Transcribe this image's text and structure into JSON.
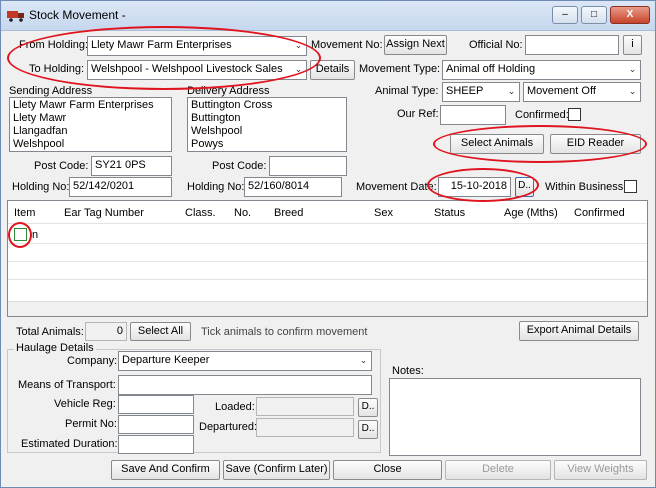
{
  "window": {
    "title": "Stock Movement -",
    "minimize": "–",
    "maximize": "□",
    "close": "X"
  },
  "holding": {
    "from_label": "From Holding:",
    "from_value": "Llety Mawr Farm Enterprises",
    "to_label": "To Holding:",
    "to_value": "Welshpool - Welshpool Livestock Sales",
    "details_button": "Details"
  },
  "movement_no": {
    "label": "Movement No:",
    "button": "Assign Next"
  },
  "official_no": {
    "label": "Official No:",
    "value": "",
    "button": "i"
  },
  "movement_type": {
    "label": "Movement Type:",
    "value": "Animal off Holding"
  },
  "animal_type": {
    "label": "Animal Type:",
    "value": "SHEEP",
    "direction": "Movement Off"
  },
  "our_ref": {
    "label": "Our Ref:",
    "value": ""
  },
  "confirmed": {
    "label": "Confirmed:"
  },
  "sending": {
    "label": "Sending Address",
    "lines": [
      "Llety Mawr Farm Enterprises",
      "Llety Mawr",
      "Llangadfan",
      "Welshpool"
    ],
    "postcode_label": "Post Code:",
    "postcode": "SY21 0PS",
    "holding_label": "Holding No:",
    "holding_no": "52/142/0201"
  },
  "delivery": {
    "label": "Delivery Address",
    "lines": [
      "Buttington Cross",
      "Buttington",
      "Welshpool",
      "Powys"
    ],
    "postcode_label": "Post Code:",
    "postcode": "",
    "holding_label": "Holding No:",
    "holding_no": "52/160/8014"
  },
  "buttons": {
    "select_animals": "Select Animals",
    "eid_reader": "EID Reader",
    "select_all": "Select All",
    "export": "Export Animal Details",
    "save_confirm": "Save And Confirm",
    "save_confirm_later": "Save (Confirm Later)",
    "close": "Close",
    "delete": "Delete",
    "view_weights": "View Weights"
  },
  "movement_date": {
    "label": "Movement Date:",
    "value": "15-10-2018",
    "button": "D.."
  },
  "within_business": {
    "label": "Within Business"
  },
  "grid": {
    "columns": [
      "Item",
      "Ear Tag Number",
      "Class.",
      "No.",
      "Breed",
      "Sex",
      "Status",
      "Age (Mths)",
      "Confirmed"
    ],
    "row_fragment": "n"
  },
  "totals": {
    "label": "Total Animals:",
    "value": "0",
    "hint": "Tick animals to confirm movement"
  },
  "haulage": {
    "group_label": "Haulage Details",
    "company_label": "Company:",
    "company_value": "Departure Keeper",
    "transport_label": "Means of Transport:",
    "transport_value": "",
    "vehicle_label": "Vehicle Reg:",
    "permit_label": "Permit No:",
    "duration_label": "Estimated Duration:",
    "loaded_label": "Loaded:",
    "departured_label": "Departured:",
    "d_button": "D.."
  },
  "notes": {
    "label": "Notes:",
    "value": ""
  },
  "colors": {
    "highlight_red": "#e0141e",
    "title_gradient": "#c6d7ee",
    "panel": "#f0f0f0"
  }
}
